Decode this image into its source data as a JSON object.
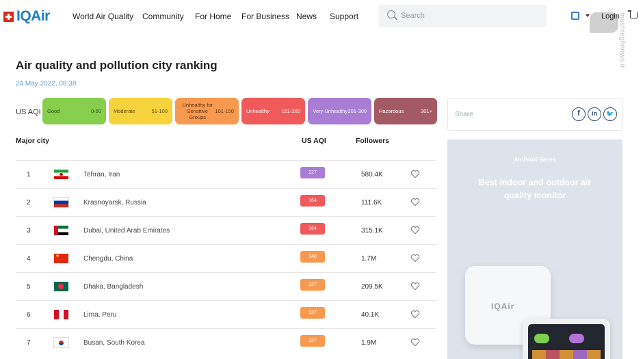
{
  "brand": {
    "logo_text": "IQAir"
  },
  "nav": {
    "items": [
      {
        "label": "World Air Quality"
      },
      {
        "label": "Community"
      },
      {
        "label": "For Home"
      },
      {
        "label": "For Business"
      },
      {
        "label": "News"
      },
      {
        "label": "Support"
      }
    ],
    "search_placeholder": "Search",
    "login_label": "Login"
  },
  "page": {
    "title": "Air quality and pollution city ranking",
    "date": "24 May 2022, 08:38"
  },
  "legend": {
    "label": "US AQI",
    "levels": [
      {
        "name": "Good",
        "range": "0-50",
        "color": "#86ce4b"
      },
      {
        "name": "Moderate",
        "range": "51-100",
        "color": "#f6d23d"
      },
      {
        "name": "Unhealthy for Sensitive Groups",
        "range": "101-150",
        "color": "#f79a4f"
      },
      {
        "name": "Unhealthy",
        "range": "151-200",
        "color": "#f05a5b"
      },
      {
        "name": "Very Unhealthy",
        "range": "201-300",
        "color": "#a97cd5"
      },
      {
        "name": "Hazardous",
        "range": "301+",
        "color": "#a45a64"
      }
    ]
  },
  "table": {
    "headers": {
      "city": "Major city",
      "aqi": "US AQI",
      "followers": "Followers"
    },
    "rows": [
      {
        "rank": "1",
        "city": "Tehran, Iran",
        "flag": "iran",
        "aqi": "227",
        "aqi_color": "#a97cd5",
        "followers": "580.4K"
      },
      {
        "rank": "2",
        "city": "Krasnoyarsk, Russia",
        "flag": "russia",
        "aqi": "164",
        "aqi_color": "#f05a5b",
        "followers": "111.6K"
      },
      {
        "rank": "3",
        "city": "Dubai, United Arab Emirates",
        "flag": "uae",
        "aqi": "164",
        "aqi_color": "#f05a5b",
        "followers": "315.1K"
      },
      {
        "rank": "4",
        "city": "Chengdu, China",
        "flag": "china",
        "aqi": "140",
        "aqi_color": "#f79a4f",
        "followers": "1.7M"
      },
      {
        "rank": "5",
        "city": "Dhaka, Bangladesh",
        "flag": "bangladesh",
        "aqi": "127",
        "aqi_color": "#f79a4f",
        "followers": "209.5K"
      },
      {
        "rank": "6",
        "city": "Lima, Peru",
        "flag": "peru",
        "aqi": "127",
        "aqi_color": "#f79a4f",
        "followers": "40.1K"
      },
      {
        "rank": "7",
        "city": "Busan, South Korea",
        "flag": "south-korea",
        "aqi": "127",
        "aqi_color": "#f79a4f",
        "followers": "1.9M"
      }
    ]
  },
  "share": {
    "label": "Share"
  },
  "ad": {
    "series": "AirVisual Series",
    "title": "Best indoor and outdoor air quality monitor",
    "device_logo": "IQAir"
  },
  "watermark": {
    "side_text": "mashreghnews.ir"
  }
}
